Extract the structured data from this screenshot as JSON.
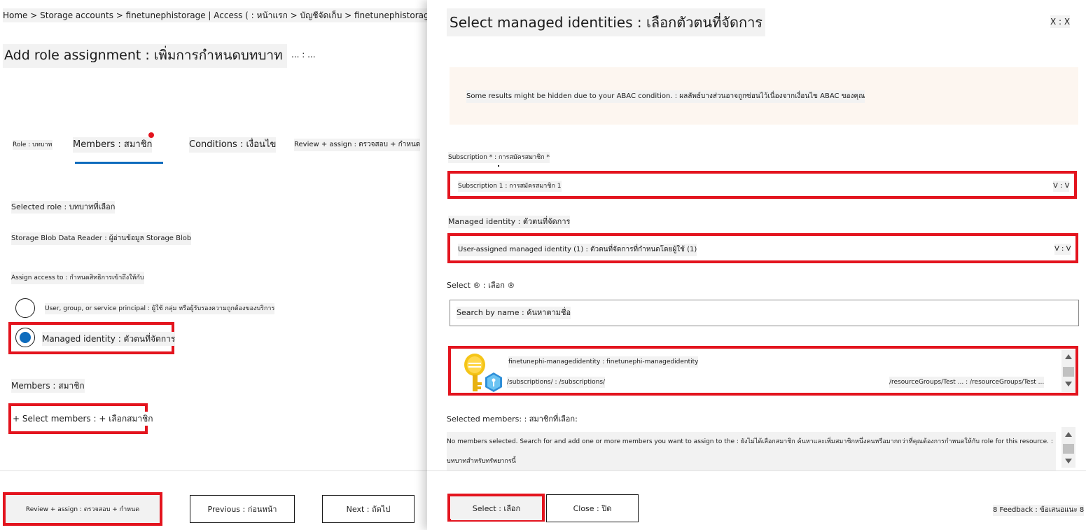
{
  "left": {
    "breadcrumb": "Home > Storage accounts > finetunephistorage | Access ( : หน้าแรก > บัญชีจัดเก็บ > finetunephistorage | การเข้าถึง (",
    "title": "Add role assignment : เพิ่มการกำหนดบทบาท",
    "more": "... : ...",
    "tabs": {
      "role": "Role : บทบาท",
      "members": "Members : สมาชิก",
      "conditions": "Conditions : เงื่อนไข",
      "review": "Review + assign : ตรวจสอบ + กำหนด"
    },
    "selected_role_label": "Selected role : บทบาทที่เลือก",
    "selected_role_value": "Storage Blob Data Reader : ผู้อ่านข้อมูล Storage Blob",
    "assign_access_label": "Assign access to : กำหนดสิทธิการเข้าถึงให้กับ",
    "options": {
      "user": "User, group, or service principal : ผู้ใช้ กลุ่ม หรือผู้รับรองความถูกต้องของบริการ",
      "managed": "Managed identity : ตัวตนที่จัดการ"
    },
    "members_label": "Members : สมาชิก",
    "select_members": "+ Select members : + เลือกสมาชิก",
    "buttons": {
      "review": "Review + assign : ตรวจสอบ + กำหนด",
      "previous": "Previous : ก่อนหน้า",
      "next": "Next : ถัดไป"
    }
  },
  "panel": {
    "title": "Select managed identities : เลือกตัวตนที่จัดการ",
    "close": "X : X",
    "notice": "Some results might be hidden due to your ABAC condition. : ผลลัพธ์บางส่วนอาจถูกซ่อนไว้เนื่องจากเงื่อนไข ABAC ของคุณ",
    "subscription_label": "Subscription * : การสมัครสมาชิก *",
    "subscription_value": "Subscription 1 : การสมัครสมาชิก 1",
    "chevron": "V : V",
    "managed_identity_label": "Managed identity : ตัวตนที่จัดการ",
    "managed_identity_value": "User-assigned managed identity (1) : ตัวตนที่จัดการที่กำหนดโดยผู้ใช้ (1)",
    "select_label": "Select ® : เลือก ®",
    "search_placeholder": "Search by name : ค้นหาตามชื่อ",
    "result": {
      "name": "finetunephi-managedidentity : finetunephi-managedidentity",
      "subscription": "/subscriptions/ : /subscriptions/",
      "resource_group": "/resourceGroups/Test ... : /resourceGroups/Test ..."
    },
    "selected_members_label": "Selected members: : สมาชิกที่เลือก:",
    "no_members_text": "No members selected. Search for and add one or more members you want to assign to the : ยังไม่ได้เลือกสมาชิก ค้นหาและเพิ่มสมาชิกหนึ่งคนหรือมากกว่าที่คุณต้องการกำหนดให้กับ role for this resource. : บทบาทสำหรับทรัพยากรนี้",
    "buttons": {
      "select": "Select : เลือก",
      "close": "Close : ปิด"
    },
    "feedback": "8 Feedback : ข้อเสนอแนะ 8"
  },
  "colors": {
    "accent": "#0f6cbd",
    "highlight_red": "#e3141e",
    "notice_bg": "#fdf6f0"
  },
  "icons": [
    "managed-identity-icon",
    "radio-icon",
    "chevron-down-icon",
    "close-icon",
    "scroll-up-icon",
    "scroll-down-icon"
  ]
}
